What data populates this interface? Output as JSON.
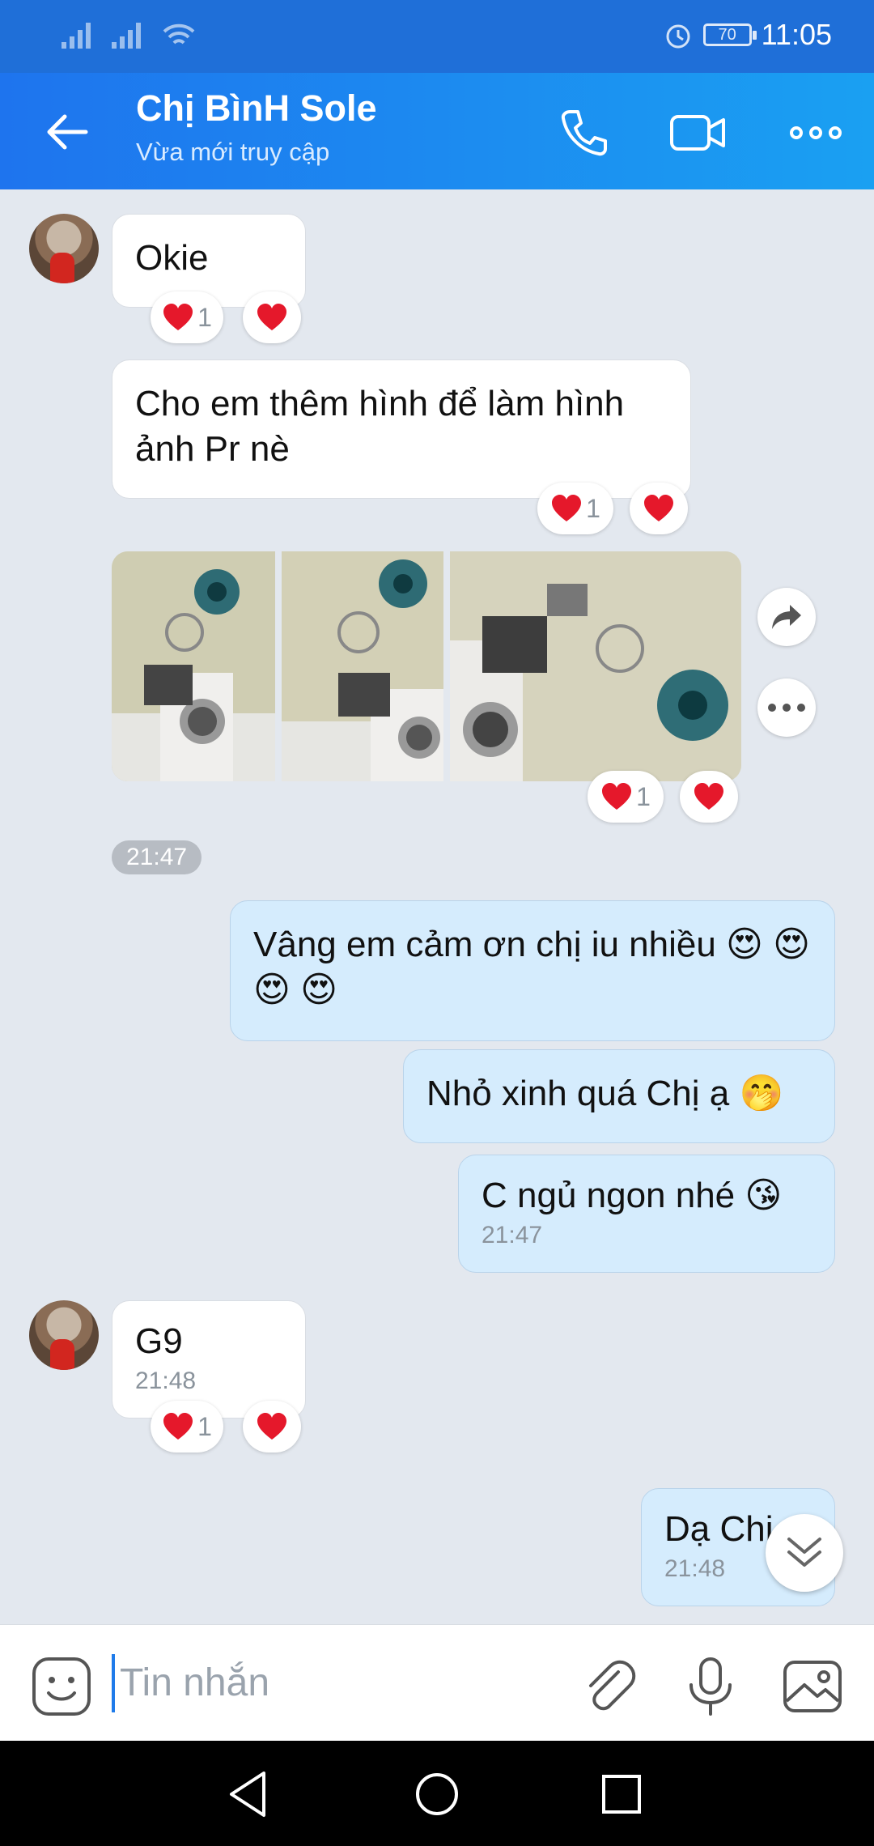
{
  "status_bar": {
    "time": "11:05",
    "battery": "70"
  },
  "header": {
    "title": "Chị BìnH Sole",
    "subtitle": "Vừa mới truy cập"
  },
  "messages": {
    "m1": {
      "text": "Okie",
      "reaction_count": "1"
    },
    "m2": {
      "text": "Cho em thêm hình để làm hình ảnh Pr nè",
      "reaction_count": "1"
    },
    "m3": {
      "reaction_count": "1"
    },
    "time_divider": "21:47",
    "m4": {
      "text": "Vâng em cảm ơn chị iu nhiều 😍 😍 😍 😍"
    },
    "m5": {
      "text": "Nhỏ xinh quá Chị ạ 🤭"
    },
    "m6": {
      "text": "C ngủ ngon nhé 😘",
      "time": "21:47"
    },
    "m7": {
      "text": "G9",
      "time": "21:48",
      "reaction_count": "1"
    },
    "m8": {
      "text": "Dạ Chị",
      "time": "21:48"
    }
  },
  "input": {
    "placeholder": "Tin nhắn"
  },
  "colors": {
    "header_start": "#1e74ee",
    "header_end": "#1aa0f2",
    "outgoing_bubble": "#d5ecfd",
    "heart": "#e5182b"
  }
}
